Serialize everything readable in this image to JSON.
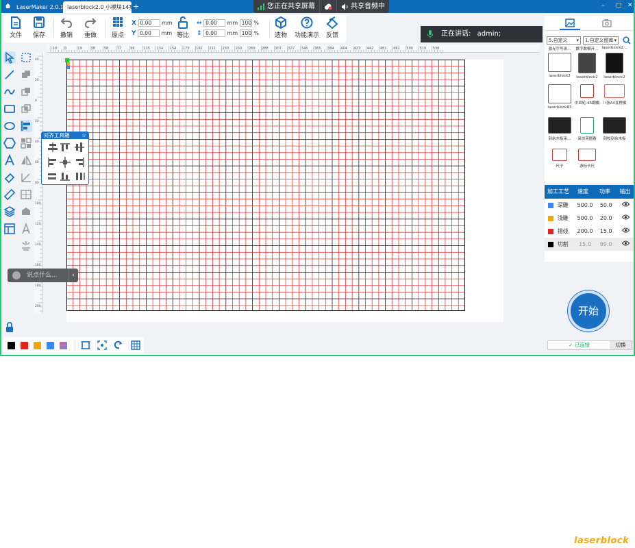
{
  "titlebar": {
    "tab1": "LaserMaker 2.0.12",
    "tab2": "laserblock2.0 小模块14案以14:",
    "share_screen": "您正在共享屏幕",
    "share_audio": "共享音频中",
    "minimize": "–",
    "maximize": "□",
    "close": "✕"
  },
  "toolbar": {
    "file": "文件",
    "save": "保存",
    "undo": "撤销",
    "redo": "重做",
    "origin": "原点",
    "x_label": "X",
    "x_value": "0.00",
    "y_label": "Y",
    "y_value": "0.00",
    "unit": "mm",
    "ratio": "等比",
    "w_value": "0.00",
    "h_value": "0.00",
    "w_pct": "100",
    "h_pct": "100",
    "pct": "%",
    "build": "造物",
    "demo": "功能演示",
    "feedback": "反馈"
  },
  "speaking": {
    "label": "正在讲话:",
    "name": "admin;"
  },
  "ruler": {
    "h_ticks": [
      "-19",
      "0",
      "19",
      "38",
      "58",
      "77",
      "96",
      "115",
      "134",
      "154",
      "173",
      "192",
      "211",
      "230",
      "250",
      "269",
      "288",
      "307",
      "327",
      "346",
      "365",
      "384",
      "404",
      "423",
      "442",
      "461",
      "481",
      "500",
      "519",
      "538"
    ],
    "v_ticks": [
      "40",
      "20",
      "0",
      "20",
      "40",
      "60",
      "80",
      "100",
      "120",
      "140",
      "160",
      "180",
      "200"
    ]
  },
  "align_panel": {
    "title": "对齐工具箱"
  },
  "say_box": {
    "placeholder": "说点什么..."
  },
  "colors": {
    "accent": "#1a6fc2",
    "palette": [
      "#000000",
      "#e8231b",
      "#f5a40b",
      "#3b86f0",
      "#ea5b8a"
    ],
    "grid_red": "#e23a3a",
    "grid_black": "#222222"
  },
  "right_panel": {
    "select1": "5.自定义",
    "select2": "1.自定义图库",
    "gallery": [
      "激光字号测…",
      "数字数模开…",
      "laserblock2…",
      "laserblock2",
      "laserblock2",
      "laserblock2",
      "laserblockA3",
      "中虫轮-45翻模",
      "八张A4瓦楞模",
      "刻余木板采…",
      "采坊亮圆看",
      "刻校刻余木板",
      "尺子",
      "游标卡尺"
    ]
  },
  "process": {
    "headers": [
      "加工工艺",
      "速度",
      "功率",
      "输出"
    ],
    "rows": [
      {
        "name": "深雕",
        "speed": "500.0",
        "power": "50.0",
        "color": "#3b86f0"
      },
      {
        "name": "浅雕",
        "speed": "500.0",
        "power": "20.0",
        "color": "#f5a40b"
      },
      {
        "name": "描线",
        "speed": "200.0",
        "power": "15.0",
        "color": "#e8231b"
      },
      {
        "name": "切割",
        "speed": "15.0",
        "power": "99.0",
        "color": "#000000"
      }
    ]
  },
  "start_button": "开始",
  "connection": {
    "status": "已连接",
    "switch": "切换"
  },
  "watermark": "laserblock"
}
